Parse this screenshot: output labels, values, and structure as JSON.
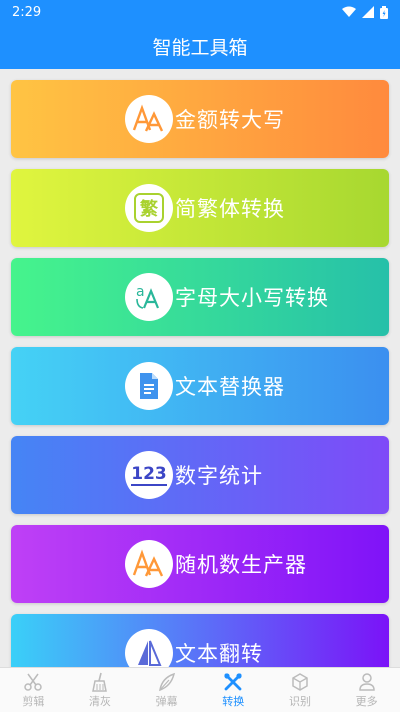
{
  "status_bar": {
    "time": "2:29"
  },
  "app_bar": {
    "title": "智能工具箱"
  },
  "cards": [
    {
      "label": "金额转大写",
      "icon": "letter-a-icon",
      "colors": [
        "#ffc443",
        "#ff8a3d"
      ]
    },
    {
      "label": "简繁体转换",
      "icon": "traditional-char-icon",
      "colors": [
        "#e0f53f",
        "#a7d830"
      ]
    },
    {
      "label": "字母大小写转换",
      "icon": "translate-icon",
      "colors": [
        "#46f48c",
        "#26c0a9"
      ]
    },
    {
      "label": "文本替换器",
      "icon": "document-icon",
      "colors": [
        "#45d2f5",
        "#3b8ff0"
      ]
    },
    {
      "label": "数字统计",
      "icon": "number-123-icon",
      "colors": [
        "#4585f5",
        "#7f4af8"
      ]
    },
    {
      "label": "随机数生产器",
      "icon": "letter-a-icon",
      "colors": [
        "#bf40f6",
        "#7f13f8"
      ]
    },
    {
      "label": "文本翻转",
      "icon": "flip-icon",
      "colors": [
        "#3ad0f8",
        "#7b13f8"
      ]
    }
  ],
  "icon_texts": {
    "traditional": "繁",
    "numbers": "123"
  },
  "bottom_nav": [
    {
      "label": "剪辑",
      "icon": "scissors-icon"
    },
    {
      "label": "清灰",
      "icon": "broom-icon"
    },
    {
      "label": "弹幕",
      "icon": "feather-icon"
    },
    {
      "label": "转换",
      "icon": "tools-icon",
      "active": true
    },
    {
      "label": "识别",
      "icon": "cube-icon"
    },
    {
      "label": "更多",
      "icon": "user-icon"
    }
  ]
}
